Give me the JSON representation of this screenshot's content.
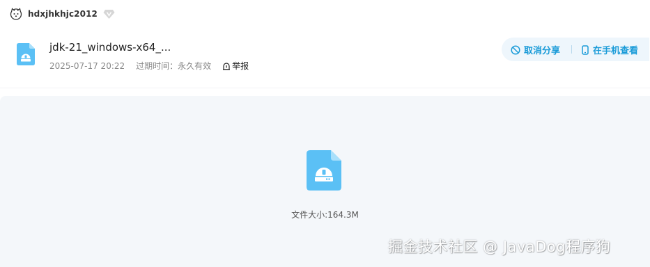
{
  "user": {
    "name": "hdxjhkhjc2012",
    "avatar_icon": "dog-avatar-icon",
    "badge_icon": "vip-diamond-icon"
  },
  "file": {
    "name": "jdk-21_windows-x64_...",
    "date": "2025-07-17 20:22",
    "expire_label": "过期时间：",
    "expire_value": "永久有效",
    "report_label": "举报",
    "size_label": "文件大小:",
    "size_value": "164.3M"
  },
  "actions": {
    "cancel_share": "取消分享",
    "view_on_phone": "在手机查看"
  },
  "watermark": {
    "text": "掘金技术社区 @ JavaDog程序狗"
  },
  "colors": {
    "accent": "#1a9bd8",
    "file_icon": "#5bc0f5",
    "preview_bg": "#f4f7fa",
    "pill_bg": "#eef6fc"
  }
}
